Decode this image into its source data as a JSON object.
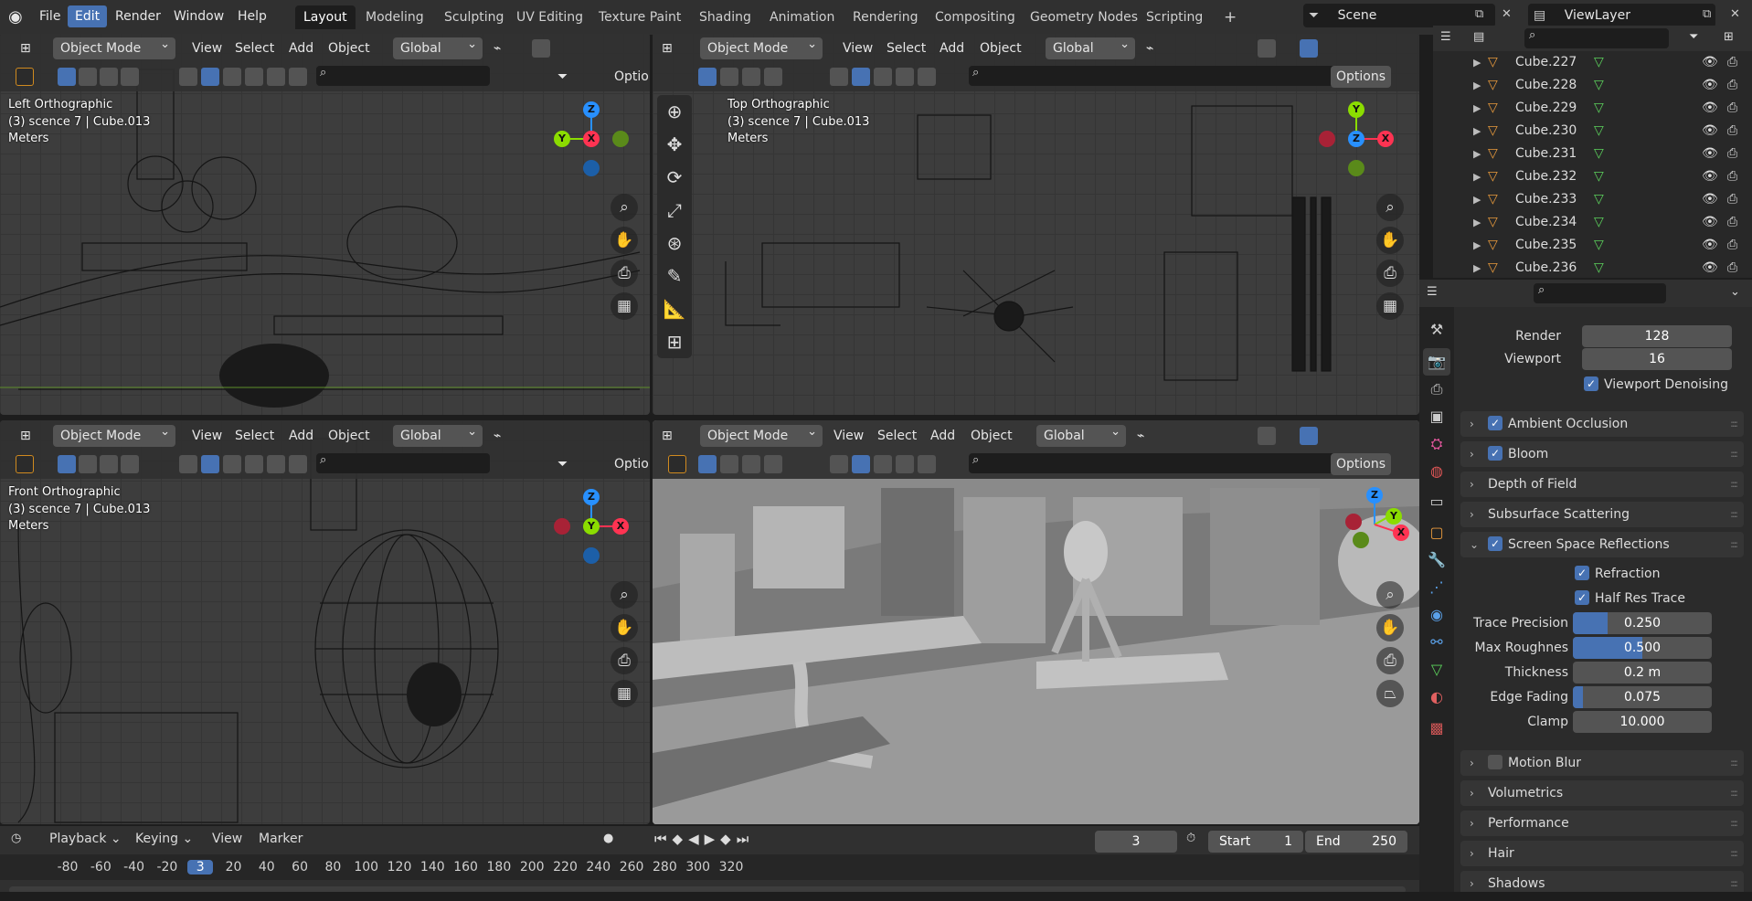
{
  "app": {
    "logo": "blender-logo-icon"
  },
  "menu": {
    "file": "File",
    "edit": "Edit",
    "render": "Render",
    "window": "Window",
    "help": "Help"
  },
  "workspaces": [
    "Layout",
    "Modeling",
    "Sculpting",
    "UV Editing",
    "Texture Paint",
    "Shading",
    "Animation",
    "Rendering",
    "Compositing",
    "Geometry Nodes",
    "Scripting"
  ],
  "workspace_add": "+",
  "scene": {
    "name": "Scene",
    "view_layer": "ViewLayer"
  },
  "viewport_header": {
    "mode": "Object Mode",
    "view": "View",
    "select": "Select",
    "add": "Add",
    "object": "Object",
    "orientation": "Global",
    "options": "Options",
    "options_clipped": "Option"
  },
  "viewports": {
    "left": {
      "view_name": "Left Orthographic",
      "collection": "(3) scence 7 | Cube.013",
      "units": "Meters"
    },
    "top": {
      "view_name": "Top Orthographic",
      "collection": "(3) scence 7 | Cube.013",
      "units": "Meters"
    },
    "front": {
      "view_name": "Front Orthographic",
      "collection": "(3) scence 7 | Cube.013",
      "units": "Meters"
    }
  },
  "gizmo_labels": {
    "x": "X",
    "y": "Y",
    "z": "Z"
  },
  "outliner": {
    "rows": [
      "Cube.227",
      "Cube.228",
      "Cube.229",
      "Cube.230",
      "Cube.231",
      "Cube.232",
      "Cube.233",
      "Cube.234",
      "Cube.235",
      "Cube.236"
    ]
  },
  "properties": {
    "samples": {
      "render_label": "Render",
      "render_value": "128",
      "viewport_label": "Viewport",
      "viewport_value": "16",
      "denoise_label": "Viewport Denoising"
    },
    "panels": {
      "ambient_occlusion": "Ambient Occlusion",
      "bloom": "Bloom",
      "depth_of_field": "Depth of Field",
      "subsurface": "Subsurface Scattering",
      "ssr": "Screen Space Reflections",
      "motion_blur": "Motion Blur",
      "volumetrics": "Volumetrics",
      "performance": "Performance",
      "hair": "Hair",
      "shadows": "Shadows"
    },
    "ssr": {
      "refraction": "Refraction",
      "half_res": "Half Res Trace",
      "trace_precision_label": "Trace Precision",
      "trace_precision": "0.250",
      "trace_precision_frac": 0.25,
      "max_roughness_label": "Max Roughnes",
      "max_roughness": "0.500",
      "max_roughness_frac": 0.5,
      "thickness_label": "Thickness",
      "thickness": "0.2 m",
      "edge_fading_label": "Edge Fading",
      "edge_fading": "0.075",
      "edge_fading_frac": 0.075,
      "clamp_label": "Clamp",
      "clamp": "10.000"
    }
  },
  "timeline": {
    "playback": "Playback",
    "keying": "Keying",
    "view": "View",
    "marker": "Marker",
    "current_frame": "3",
    "start_label": "Start",
    "start": "1",
    "end_label": "End",
    "end": "250",
    "ruler": [
      "-80",
      "-60",
      "-40",
      "-20",
      "3",
      "20",
      "40",
      "60",
      "80",
      "100",
      "120",
      "140",
      "160",
      "180",
      "200",
      "220",
      "240",
      "260",
      "280",
      "300",
      "320"
    ]
  },
  "colors": {
    "accent": "#4772b3",
    "axis_x": "#ff3352",
    "axis_y": "#8bdc00",
    "axis_z": "#2890ff"
  }
}
